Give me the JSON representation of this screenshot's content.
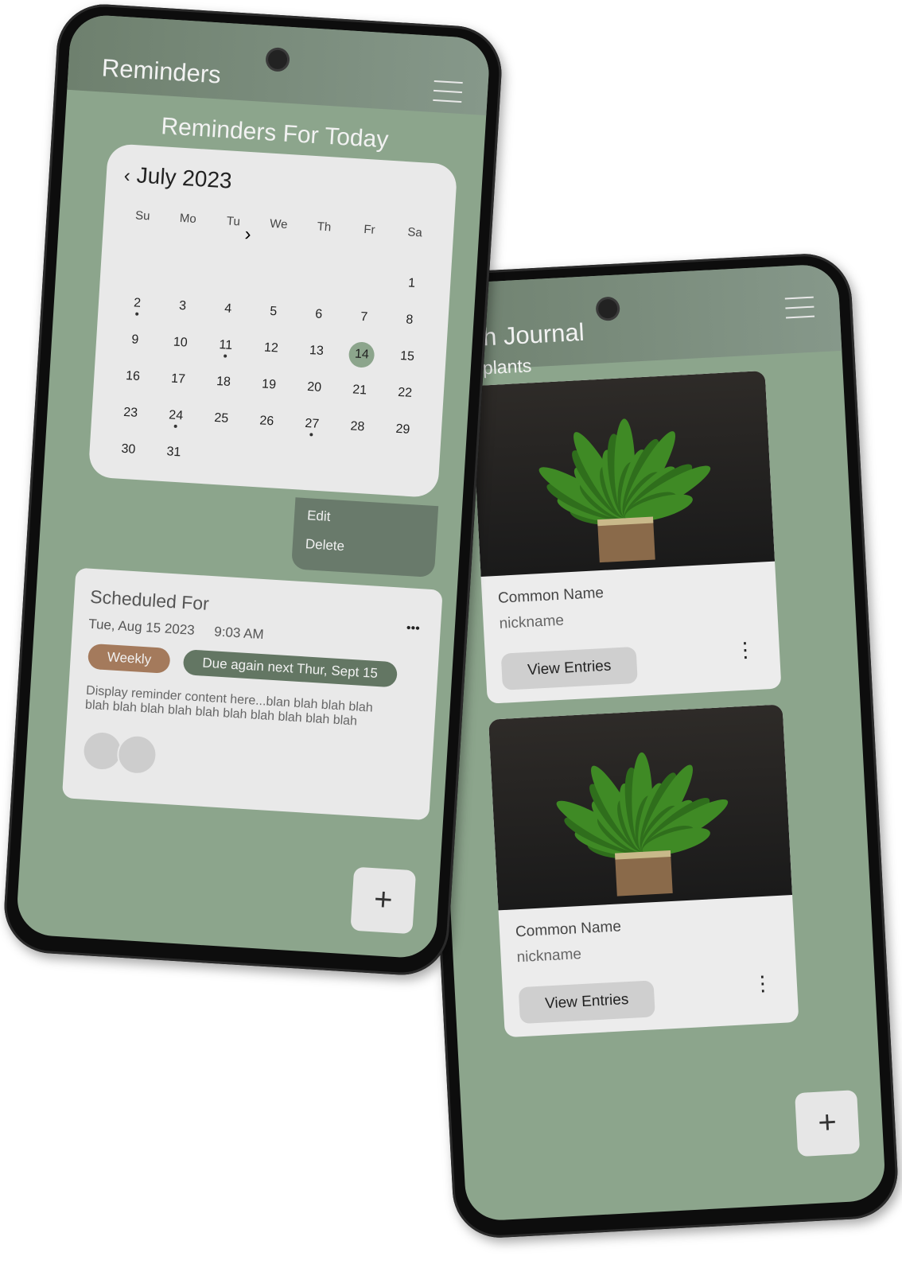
{
  "journal": {
    "title_fragment": "owth Journal",
    "subtitle_fragment": "rent plants",
    "plants": [
      {
        "common_name": "Common Name",
        "nickname": "nickname",
        "button": "View Entries"
      },
      {
        "common_name": "Common Name",
        "nickname": "nickname",
        "button": "View Entries"
      }
    ],
    "fab": "+"
  },
  "reminders": {
    "title": "Reminders",
    "subtitle": "Reminders For Today",
    "calendar": {
      "month": "July 2023",
      "weekdays": [
        "Su",
        "Mo",
        "Tu",
        "We",
        "Th",
        "Fr",
        "Sa"
      ],
      "selected_day": 14,
      "dot_days": [
        2,
        11,
        24,
        27
      ]
    },
    "menu": {
      "edit": "Edit",
      "delete": "Delete"
    },
    "card": {
      "heading": "Scheduled For",
      "date": "Tue,  Aug 15 2023",
      "time": "9:03 AM",
      "frequency": "Weekly",
      "due": "Due again next Thur, Sept 15",
      "content": "Display reminder content here...blan blah blah blah blah blah blah blah blah blah blah blah blah blah",
      "more": "•••"
    },
    "fab": "+"
  },
  "colors": {
    "bg": "#8ca58c",
    "header": "#6e806e",
    "weekly": "#a47a5c",
    "due": "#637663"
  }
}
